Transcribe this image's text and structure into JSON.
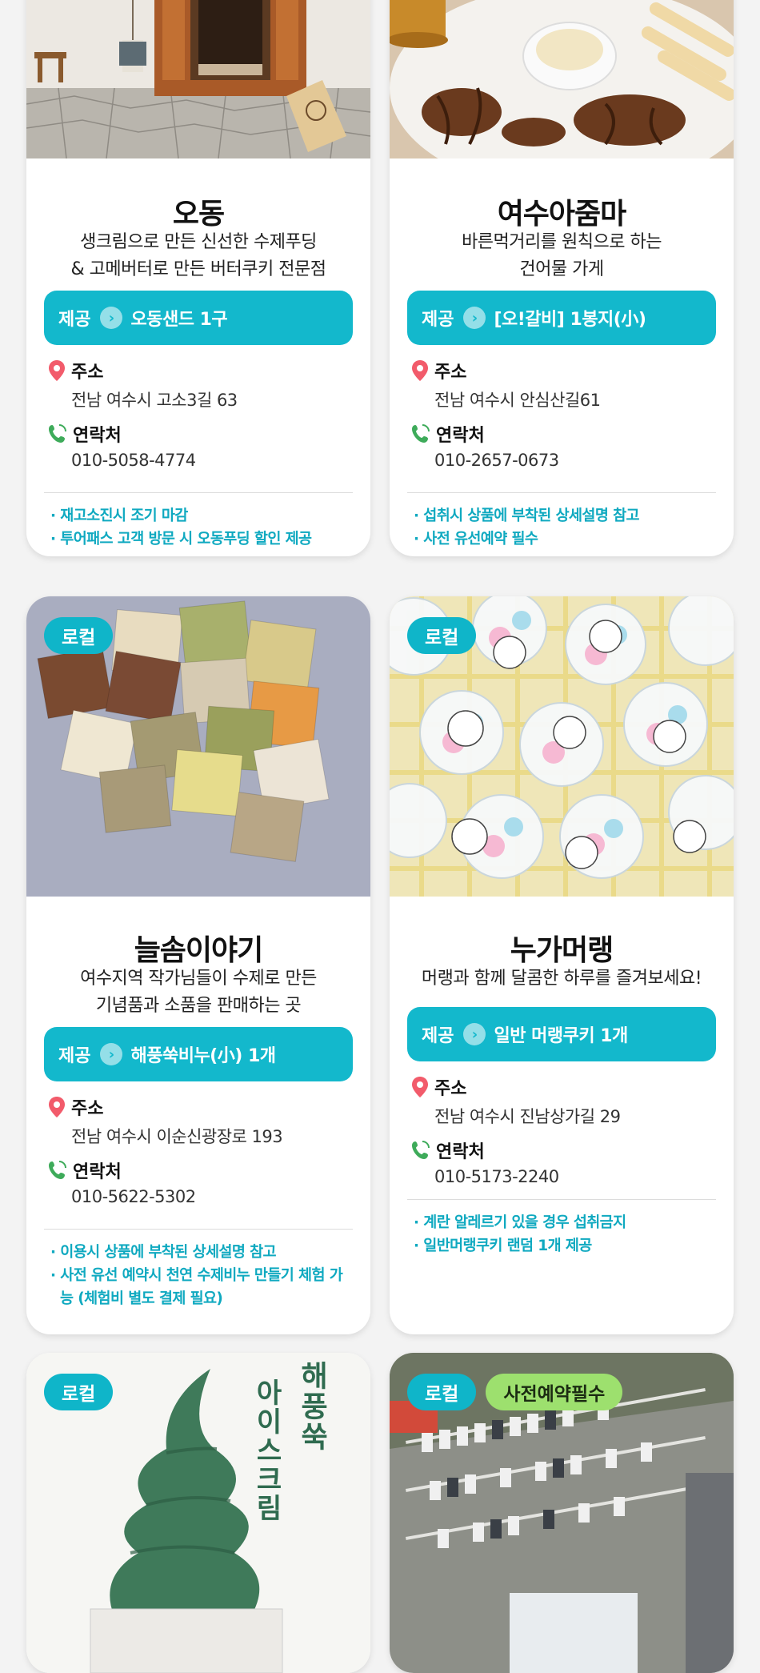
{
  "cards": [
    {
      "title": "오동",
      "desc_lines": [
        "생크림으로 만든 신선한 수제푸딩",
        "& 고메버터로 만든 버터쿠키 전문점"
      ],
      "offer_label": "제공",
      "offer_item": "오동샌드 1구",
      "address_label": "주소",
      "address": "전남 여수시 고소3길 63",
      "contact_label": "연락처",
      "phone": "010-5058-4774",
      "notes": [
        "· 재고소진시 조기 마감",
        "· 투어패스 고객 방문 시 오동푸딩 할인 제공"
      ]
    },
    {
      "title": "여수아줌마",
      "desc_lines": [
        "바른먹거리를 원칙으로 하는",
        "건어물 가게"
      ],
      "offer_label": "제공",
      "offer_item": "[오!갈비] 1봉지(小)",
      "address_label": "주소",
      "address": "전남 여수시 안심산길61",
      "contact_label": "연락처",
      "phone": "010-2657-0673",
      "notes": [
        "· 섭취시 상품에 부착된 상세설명 참고",
        "· 사전 유선예약 필수"
      ]
    },
    {
      "badges": [
        "로컬"
      ],
      "title": "늘솜이야기",
      "desc_lines": [
        "여수지역 작가님들이 수제로 만든",
        "기념품과 소품을 판매하는 곳"
      ],
      "offer_label": "제공",
      "offer_item": "해풍쑥비누(小) 1개",
      "address_label": "주소",
      "address": "전남 여수시 이순신광장로 193",
      "contact_label": "연락처",
      "phone": "010-5622-5302",
      "notes": [
        "· 이용시 상품에 부착된 상세설명 참고",
        "· 사전 유선 예약시 천연 수제비누 만들기 체험 가능 (체험비 별도 결제 필요)"
      ]
    },
    {
      "badges": [
        "로컬"
      ],
      "title": "누가머랭",
      "desc_lines": [
        "머랭과 함께 달콤한 하루를 즐겨보세요!"
      ],
      "offer_label": "제공",
      "offer_item": "일반 머랭쿠키 1개",
      "address_label": "주소",
      "address": "전남 여수시 진남상가길 29",
      "contact_label": "연락처",
      "phone": "010-5173-2240",
      "notes": [
        "· 계란 알레르기 있을 경우 섭취금지",
        "· 일반머랭쿠키 랜덤 1개 제공"
      ]
    },
    {
      "badges": [
        "로컬"
      ],
      "image_text": [
        "해풍쑥",
        "아이스크림"
      ]
    },
    {
      "badges": [
        "로컬",
        "사전예약필수"
      ]
    }
  ],
  "colors": {
    "accent": "#13b8cc",
    "note": "#0fa9c0",
    "green_badge": "#9de06e"
  }
}
